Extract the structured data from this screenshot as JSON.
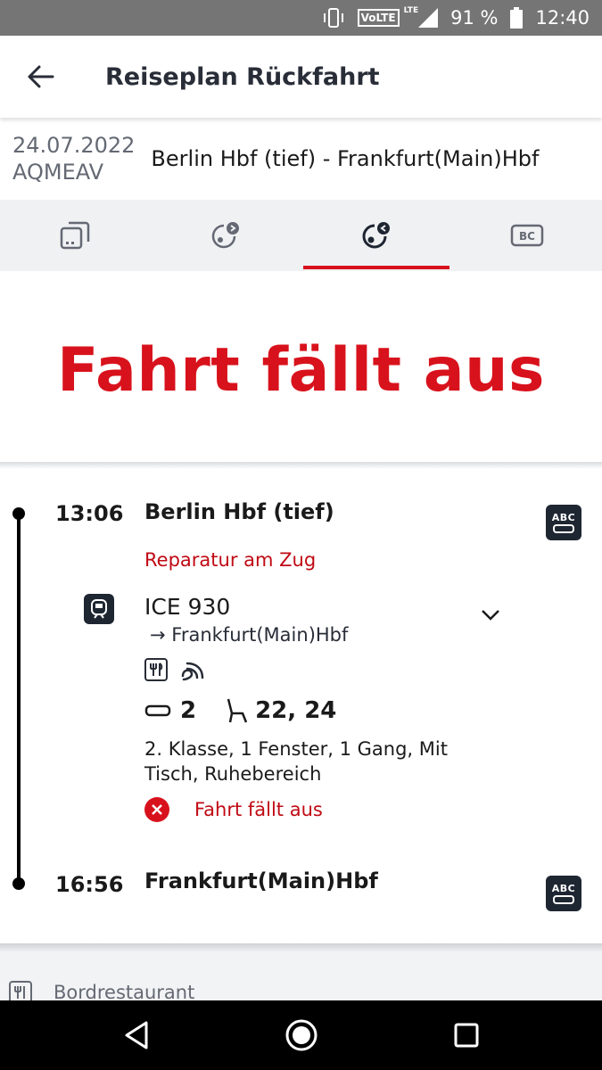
{
  "status_bar": {
    "volte": "VoLTE",
    "lte": "LTE",
    "battery": "91 %",
    "time": "12:40"
  },
  "header": {
    "title": "Reiseplan Rückfahrt"
  },
  "trip": {
    "date": "24.07.2022",
    "booking_code": "AQMEAV",
    "route": "Berlin Hbf (tief) - Frankfurt(Main)Hbf"
  },
  "tabs": [
    {
      "name": "ticket",
      "icon": "ticket-icon",
      "active": false
    },
    {
      "name": "outbound",
      "icon": "outbound-journey-icon",
      "active": false
    },
    {
      "name": "return",
      "icon": "return-journey-icon",
      "active": true
    },
    {
      "name": "bahncard",
      "icon": "bahncard-icon",
      "label": "BC",
      "active": false
    }
  ],
  "banner": {
    "text": "Fahrt fällt aus"
  },
  "journey": {
    "departure": {
      "time": "13:06",
      "station": "Berlin Hbf (tief)",
      "note": "Reparatur am Zug",
      "seat_map_label": "ABC"
    },
    "train": {
      "name": "ICE 930",
      "destination": "→ Frankfurt(Main)Hbf",
      "amenities": [
        "restaurant-icon",
        "wifi-icon"
      ],
      "coach": "2",
      "seats": "22, 24",
      "description": "2. Klasse, 1 Fenster, 1 Gang, Mit Tisch, Ruhebereich",
      "status": "Fahrt fällt aus"
    },
    "arrival": {
      "time": "16:56",
      "station": "Frankfurt(Main)Hbf",
      "seat_map_label": "ABC"
    }
  },
  "footer": {
    "amenity_label": "Bordrestaurant"
  },
  "colors": {
    "accent": "#d8121c",
    "dark": "#1e2632",
    "tab_bg": "#eff1f3"
  }
}
